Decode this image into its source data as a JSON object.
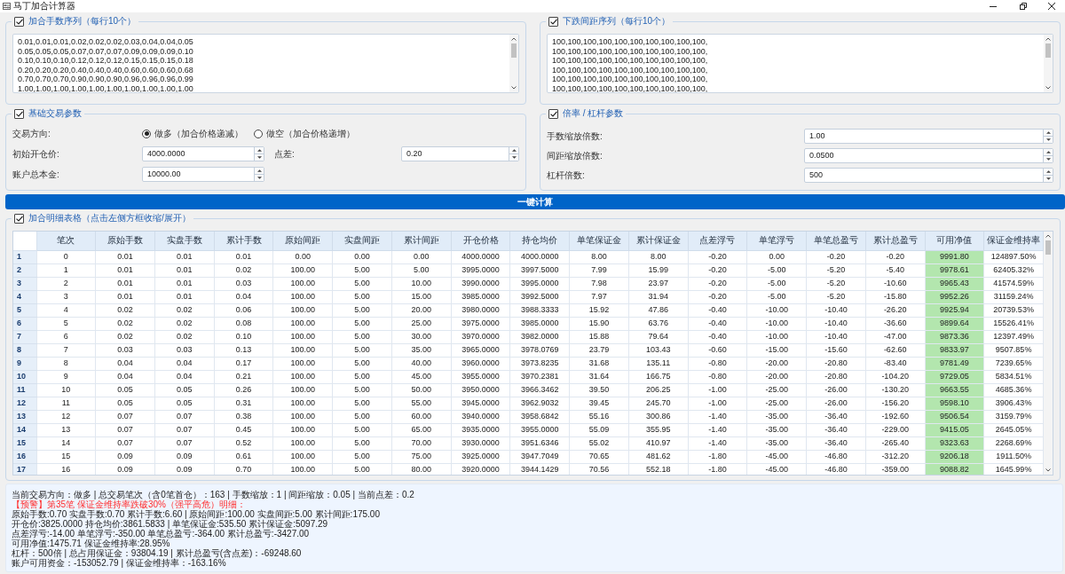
{
  "window": {
    "title": "马丁加合计算器"
  },
  "lot_sequence": {
    "title": "加合手数序列（每行10个）",
    "checked": true,
    "lines": [
      "0.01,0.01,0.01,0.02,0.02,0.02,0.03,0.04,0.04,0.05",
      "0.05,0.05,0.05,0.07,0.07,0.07,0.09,0.09,0.09,0.10",
      "0.10,0.10,0.10,0.12,0.12,0.12,0.15,0.15,0.15,0.18",
      "0.20,0.20,0.20,0.40,0.40,0.40,0.60,0.60,0.60,0.68",
      "0.70,0.70,0.70,0.90,0.90,0.90,0.96,0.96,0.96,0.99",
      "1.00,1.00,1.00,1.00,1.00,1.00,1.00,1.00,1.00,1.00"
    ]
  },
  "spacing_sequence": {
    "title": "下跌间距序列（每行10个）",
    "checked": true,
    "lines": [
      "100,100,100,100,100,100,100,100,100,100,",
      "100,100,100,100,100,100,100,100,100,100,",
      "100,100,100,100,100,100,100,100,100,100,",
      "100,100,100,100,100,100,100,100,100,100,",
      "100,100,100,100,100,100,100,100,100,100,",
      "100,100,100,100,100,100,100,100,100,100,"
    ]
  },
  "basic_params": {
    "title": "基础交易参数",
    "checked": true,
    "direction_label": "交易方向:",
    "direction_options": [
      {
        "label": "做多（加合价格递减）",
        "selected": true
      },
      {
        "label": "做空（加合价格递增）",
        "selected": false
      }
    ],
    "fields": [
      {
        "label": "初始开仓价:",
        "value": "4000.0000"
      },
      {
        "label": "点差:",
        "value": "0.20"
      },
      {
        "label": "账户总本金:",
        "value": "10000.00"
      }
    ]
  },
  "multiplier_params": {
    "title": "倍率 / 杠杆参数",
    "checked": true,
    "fields": [
      {
        "label": "手数缩放倍数:",
        "value": "1.00"
      },
      {
        "label": "间距缩放倍数:",
        "value": "0.0500"
      },
      {
        "label": "杠杆倍数:",
        "value": "500"
      }
    ]
  },
  "calculate_button": "一键计算",
  "detail_table": {
    "title": "加合明细表格（点击左侧方框收缩/展开）",
    "checked": true,
    "columns": [
      {
        "label": "笔次",
        "highlighted": false
      },
      {
        "label": "原始手数",
        "highlighted": false
      },
      {
        "label": "实盘手数",
        "highlighted": false
      },
      {
        "label": "累计手数",
        "highlighted": false
      },
      {
        "label": "原始间距",
        "highlighted": false
      },
      {
        "label": "实盘间距",
        "highlighted": false
      },
      {
        "label": "累计间距",
        "highlighted": false
      },
      {
        "label": "开仓价格",
        "highlighted": false
      },
      {
        "label": "持仓均价",
        "highlighted": false
      },
      {
        "label": "单笔保证金",
        "highlighted": false
      },
      {
        "label": "累计保证金",
        "highlighted": false
      },
      {
        "label": "点差浮亏",
        "highlighted": false
      },
      {
        "label": "单笔浮亏",
        "highlighted": false
      },
      {
        "label": "单笔总盈亏",
        "highlighted": false
      },
      {
        "label": "累计总盈亏",
        "highlighted": false
      },
      {
        "label": "可用净值",
        "highlighted": true
      },
      {
        "label": "保证金维持率",
        "highlighted": false
      }
    ],
    "rows": [
      {
        "label": "1",
        "cells": [
          "0",
          "0.01",
          "0.01",
          "0.01",
          "0.00",
          "0.00",
          "0.00",
          "4000.0000",
          "4000.0000",
          "8.00",
          "8.00",
          "-0.20",
          "0.00",
          "-0.20",
          "-0.20",
          "9991.80",
          "124897.50%"
        ]
      },
      {
        "label": "2",
        "cells": [
          "1",
          "0.01",
          "0.01",
          "0.02",
          "100.00",
          "5.00",
          "5.00",
          "3995.0000",
          "3997.5000",
          "7.99",
          "15.99",
          "-0.20",
          "-5.00",
          "-5.20",
          "-5.40",
          "9978.61",
          "62405.32%"
        ]
      },
      {
        "label": "3",
        "cells": [
          "2",
          "0.01",
          "0.01",
          "0.03",
          "100.00",
          "5.00",
          "10.00",
          "3990.0000",
          "3995.0000",
          "7.98",
          "23.97",
          "-0.20",
          "-5.00",
          "-5.20",
          "-10.60",
          "9965.43",
          "41574.59%"
        ]
      },
      {
        "label": "4",
        "cells": [
          "3",
          "0.01",
          "0.01",
          "0.04",
          "100.00",
          "5.00",
          "15.00",
          "3985.0000",
          "3992.5000",
          "7.97",
          "31.94",
          "-0.20",
          "-5.00",
          "-5.20",
          "-15.80",
          "9952.26",
          "31159.24%"
        ]
      },
      {
        "label": "5",
        "cells": [
          "4",
          "0.02",
          "0.02",
          "0.06",
          "100.00",
          "5.00",
          "20.00",
          "3980.0000",
          "3988.3333",
          "15.92",
          "47.86",
          "-0.40",
          "-10.00",
          "-10.40",
          "-26.20",
          "9925.94",
          "20739.53%"
        ]
      },
      {
        "label": "6",
        "cells": [
          "5",
          "0.02",
          "0.02",
          "0.08",
          "100.00",
          "5.00",
          "25.00",
          "3975.0000",
          "3985.0000",
          "15.90",
          "63.76",
          "-0.40",
          "-10.00",
          "-10.40",
          "-36.60",
          "9899.64",
          "15526.41%"
        ]
      },
      {
        "label": "7",
        "cells": [
          "6",
          "0.02",
          "0.02",
          "0.10",
          "100.00",
          "5.00",
          "30.00",
          "3970.0000",
          "3982.0000",
          "15.88",
          "79.64",
          "-0.40",
          "-10.00",
          "-10.40",
          "-47.00",
          "9873.36",
          "12397.49%"
        ]
      },
      {
        "label": "8",
        "cells": [
          "7",
          "0.03",
          "0.03",
          "0.13",
          "100.00",
          "5.00",
          "35.00",
          "3965.0000",
          "3978.0769",
          "23.79",
          "103.43",
          "-0.60",
          "-15.00",
          "-15.60",
          "-62.60",
          "9833.97",
          "9507.85%"
        ]
      },
      {
        "label": "9",
        "cells": [
          "8",
          "0.04",
          "0.04",
          "0.17",
          "100.00",
          "5.00",
          "40.00",
          "3960.0000",
          "3973.8235",
          "31.68",
          "135.11",
          "-0.80",
          "-20.00",
          "-20.80",
          "-83.40",
          "9781.49",
          "7239.65%"
        ]
      },
      {
        "label": "10",
        "cells": [
          "9",
          "0.04",
          "0.04",
          "0.21",
          "100.00",
          "5.00",
          "45.00",
          "3955.0000",
          "3970.2381",
          "31.64",
          "166.75",
          "-0.80",
          "-20.00",
          "-20.80",
          "-104.20",
          "9729.05",
          "5834.51%"
        ]
      },
      {
        "label": "11",
        "cells": [
          "10",
          "0.05",
          "0.05",
          "0.26",
          "100.00",
          "5.00",
          "50.00",
          "3950.0000",
          "3966.3462",
          "39.50",
          "206.25",
          "-1.00",
          "-25.00",
          "-26.00",
          "-130.20",
          "9663.55",
          "4685.36%"
        ]
      },
      {
        "label": "12",
        "cells": [
          "11",
          "0.05",
          "0.05",
          "0.31",
          "100.00",
          "5.00",
          "55.00",
          "3945.0000",
          "3962.9032",
          "39.45",
          "245.70",
          "-1.00",
          "-25.00",
          "-26.00",
          "-156.20",
          "9598.10",
          "3906.43%"
        ]
      },
      {
        "label": "13",
        "cells": [
          "12",
          "0.07",
          "0.07",
          "0.38",
          "100.00",
          "5.00",
          "60.00",
          "3940.0000",
          "3958.6842",
          "55.16",
          "300.86",
          "-1.40",
          "-35.00",
          "-36.40",
          "-192.60",
          "9506.54",
          "3159.79%"
        ]
      },
      {
        "label": "14",
        "cells": [
          "13",
          "0.07",
          "0.07",
          "0.45",
          "100.00",
          "5.00",
          "65.00",
          "3935.0000",
          "3955.0000",
          "55.09",
          "355.95",
          "-1.40",
          "-35.00",
          "-36.40",
          "-229.00",
          "9415.05",
          "2645.05%"
        ]
      },
      {
        "label": "15",
        "cells": [
          "14",
          "0.07",
          "0.07",
          "0.52",
          "100.00",
          "5.00",
          "70.00",
          "3930.0000",
          "3951.6346",
          "55.02",
          "410.97",
          "-1.40",
          "-35.00",
          "-36.40",
          "-265.40",
          "9323.63",
          "2268.69%"
        ]
      },
      {
        "label": "16",
        "cells": [
          "15",
          "0.09",
          "0.09",
          "0.61",
          "100.00",
          "5.00",
          "75.00",
          "3925.0000",
          "3947.7049",
          "70.65",
          "481.62",
          "-1.80",
          "-45.00",
          "-46.80",
          "-312.20",
          "9206.18",
          "1911.50%"
        ]
      },
      {
        "label": "17",
        "cells": [
          "16",
          "0.09",
          "0.09",
          "0.70",
          "100.00",
          "5.00",
          "80.00",
          "3920.0000",
          "3944.1429",
          "70.56",
          "552.18",
          "-1.80",
          "-45.00",
          "-46.80",
          "-359.00",
          "9088.82",
          "1645.99%"
        ]
      }
    ]
  },
  "summary": {
    "lines": [
      {
        "kind": "info",
        "text": "当前交易方向：做多 | 总交易笔次（含0笔首仓）：163 | 手数缩放：1 | 间距缩放：0.05 | 当前点差：0.2"
      },
      {
        "kind": "warning",
        "text": "【预警】第35笔 保证金维持率跌破30%（强平高危）明细："
      },
      {
        "kind": "info",
        "text": "原始手数:0.70 实盘手数:0.70 累计手数:6.60 | 原始间距:100.00 实盘间距:5.00 累计间距:175.00"
      },
      {
        "kind": "info",
        "text": "开仓价:3825.0000 持仓均价:3861.5833 | 单笔保证金:535.50 累计保证金:5097.29"
      },
      {
        "kind": "info",
        "text": "点差浮亏:-14.00 单笔浮亏:-350.00 单笔总盈亏:-364.00 累计总盈亏:-3427.00"
      },
      {
        "kind": "info",
        "text": "可用净值:1475.71 保证金维持率:28.95%"
      },
      {
        "kind": "info",
        "text": "杠杆：500倍 | 总占用保证金：93804.19 | 累计总盈亏(含点差)：-69248.60"
      },
      {
        "kind": "info",
        "text": "账户可用资金：-153052.79 | 保证金维持率：-163.16%"
      }
    ]
  }
}
